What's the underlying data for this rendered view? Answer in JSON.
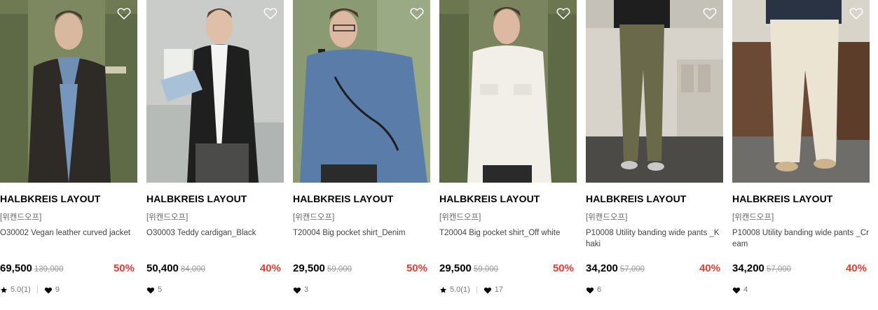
{
  "colors": {
    "discount": "#ef3a2e",
    "original_price": "#9a9a9a",
    "brand": "#000000"
  },
  "icons": {
    "wishlist": "heart-outline-icon",
    "rating": "star-icon",
    "likes": "heart-filled-icon"
  },
  "products": [
    {
      "brand": "HALBKREIS LAYOUT",
      "promo": "[위캔드오프]",
      "name": "O30002 Vegan leather curved jacket",
      "price": "69,500",
      "original_price": "139,000",
      "discount": "50%",
      "rating": "5.0(1)",
      "likes": "9"
    },
    {
      "brand": "HALBKREIS LAYOUT",
      "promo": "[위캔드오프]",
      "name": "O30003 Teddy cardigan_Black",
      "price": "50,400",
      "original_price": "84,000",
      "discount": "40%",
      "rating": "",
      "likes": "5"
    },
    {
      "brand": "HALBKREIS LAYOUT",
      "promo": "[위캔드오프]",
      "name": "T20004 Big pocket shirt_Denim",
      "price": "29,500",
      "original_price": "59,000",
      "discount": "50%",
      "rating": "",
      "likes": "3"
    },
    {
      "brand": "HALBKREIS LAYOUT",
      "promo": "[위캔드오프]",
      "name": "T20004 Big pocket shirt_Off white",
      "price": "29,500",
      "original_price": "59,000",
      "discount": "50%",
      "rating": "5.0(1)",
      "likes": "17"
    },
    {
      "brand": "HALBKREIS LAYOUT",
      "promo": "[위캔드오프]",
      "name": "P10008 Utility banding wide pants _Khaki",
      "price": "34,200",
      "original_price": "57,000",
      "discount": "40%",
      "rating": "",
      "likes": "6"
    },
    {
      "brand": "HALBKREIS LAYOUT",
      "promo": "[위캔드오프]",
      "name": "P10008 Utility banding wide pants _Cream",
      "price": "34,200",
      "original_price": "57,000",
      "discount": "40%",
      "rating": "",
      "likes": "4"
    }
  ]
}
